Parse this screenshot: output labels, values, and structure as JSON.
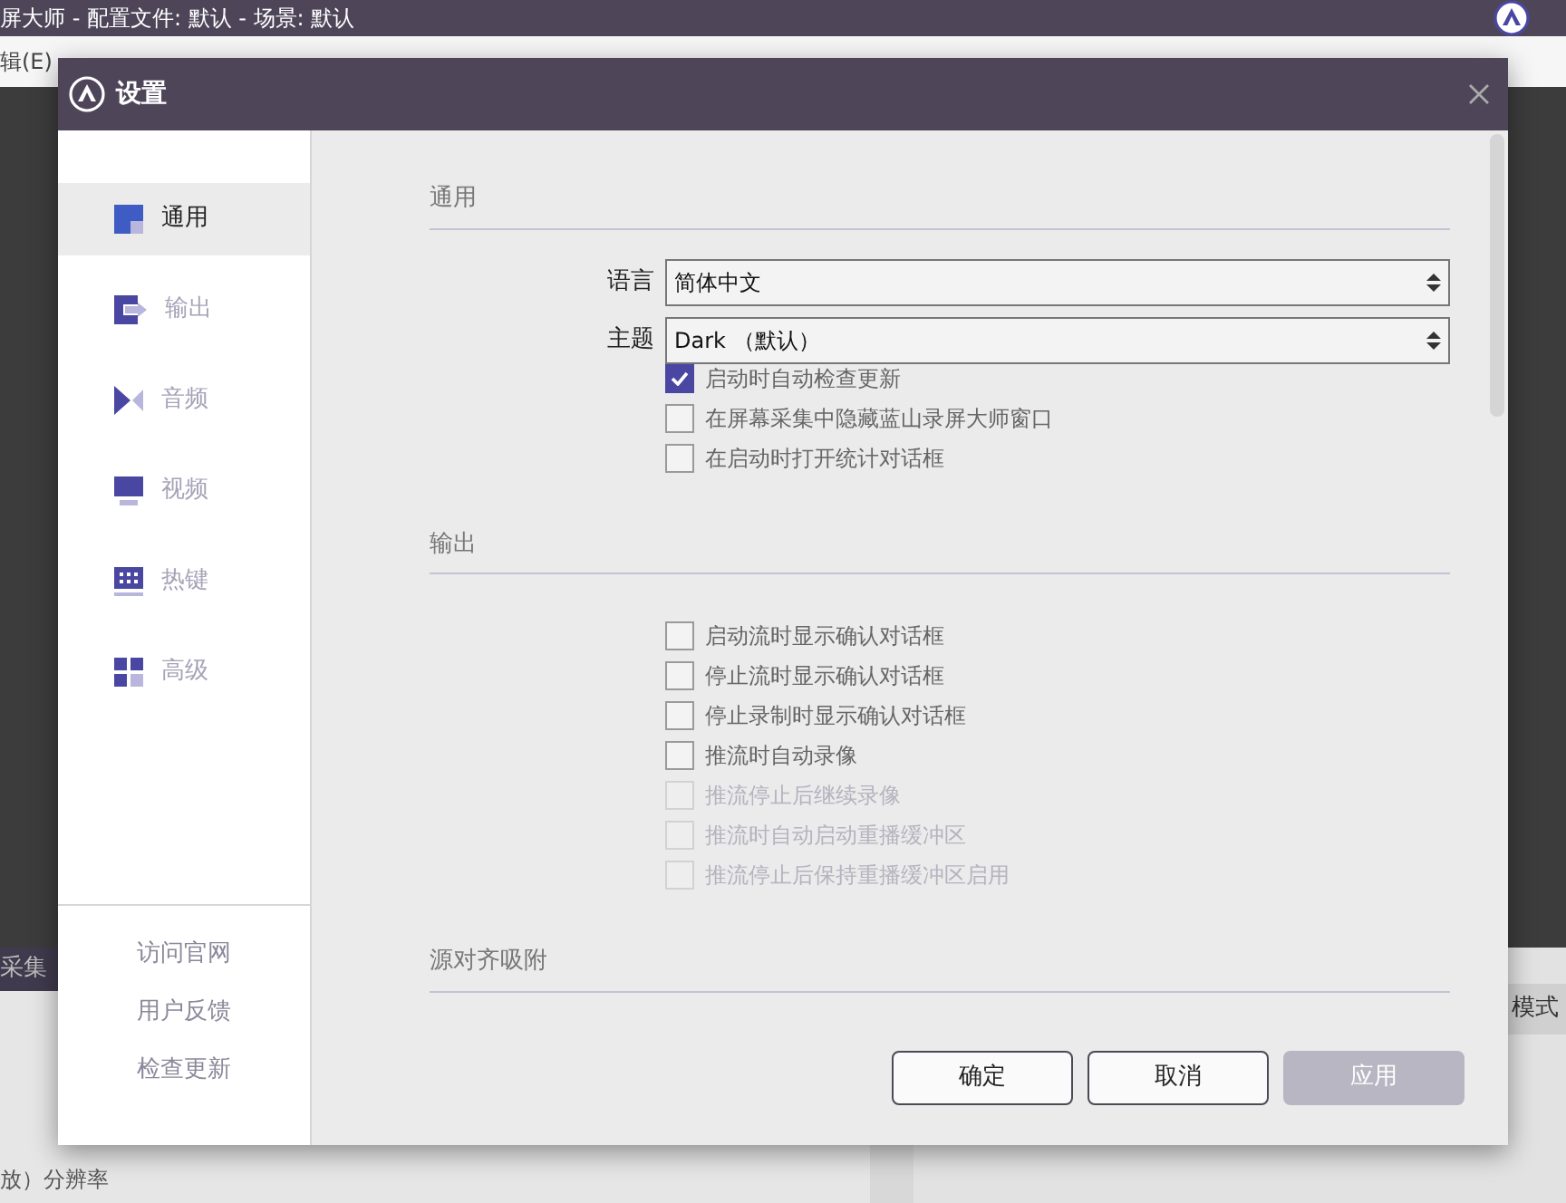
{
  "app": {
    "title": "屏大师  - 配置文件: 默认 - 场景: 默认",
    "menu": [
      "辑(E)"
    ],
    "dock_title": "采集",
    "dock_label": "放）分辨率",
    "right_label": "模式"
  },
  "dialog": {
    "title": "设置",
    "sidebar": {
      "items": [
        {
          "label": "通用",
          "kind": "general",
          "selected": true
        },
        {
          "label": "输出",
          "kind": "output",
          "selected": false
        },
        {
          "label": "音频",
          "kind": "audio",
          "selected": false
        },
        {
          "label": "视频",
          "kind": "video",
          "selected": false
        },
        {
          "label": "热键",
          "kind": "hotkeys",
          "selected": false
        },
        {
          "label": "高级",
          "kind": "advanced",
          "selected": false
        }
      ],
      "links": [
        "访问官网",
        "用户反馈",
        "检查更新"
      ]
    },
    "sections": [
      {
        "title": "通用",
        "selects": [
          {
            "label": "语言",
            "value": "简体中文"
          },
          {
            "label": "主题",
            "value": "Dark （默认）"
          }
        ],
        "checkboxes": [
          {
            "label": "启动时自动检查更新",
            "checked": true,
            "disabled": false
          },
          {
            "label": "在屏幕采集中隐藏蓝山录屏大师窗口",
            "checked": false,
            "disabled": false
          },
          {
            "label": "在启动时打开统计对话框",
            "checked": false,
            "disabled": false
          }
        ]
      },
      {
        "title": "输出",
        "checkboxes": [
          {
            "label": "启动流时显示确认对话框",
            "checked": false,
            "disabled": false
          },
          {
            "label": "停止流时显示确认对话框",
            "checked": false,
            "disabled": false
          },
          {
            "label": "停止录制时显示确认对话框",
            "checked": false,
            "disabled": false
          },
          {
            "label": "推流时自动录像",
            "checked": false,
            "disabled": false
          },
          {
            "label": "推流停止后继续录像",
            "checked": false,
            "disabled": true
          },
          {
            "label": "推流时自动启动重播缓冲区",
            "checked": false,
            "disabled": true
          },
          {
            "label": "推流停止后保持重播缓冲区启用",
            "checked": false,
            "disabled": true
          }
        ]
      },
      {
        "title": "源对齐吸附"
      }
    ],
    "buttons": [
      {
        "label": "确定",
        "disabled": false
      },
      {
        "label": "取消",
        "disabled": false
      },
      {
        "label": "应用",
        "disabled": true
      }
    ]
  }
}
